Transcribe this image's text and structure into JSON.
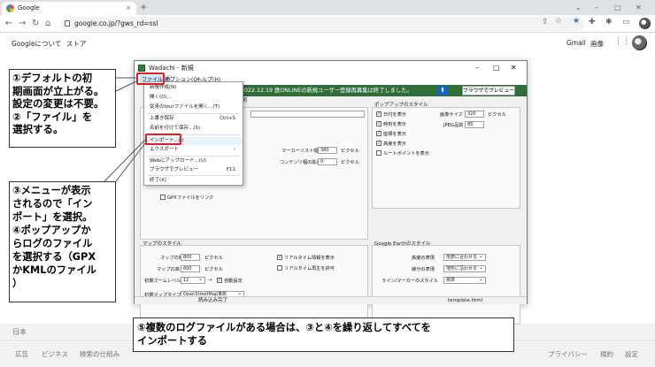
{
  "browser": {
    "tab_title": "Google",
    "tab_close": "×",
    "new_tab": "+",
    "url": "google.co.jp/?gws_rd=ssl",
    "window_controls": [
      "⌄",
      "–",
      "□",
      "✕"
    ]
  },
  "google": {
    "about": "Googleについて",
    "store": "ストア",
    "gmail": "Gmail",
    "images": "画像",
    "footer_country": "日本",
    "footer_left": [
      "広告",
      "ビジネス",
      "検索の仕組み"
    ],
    "footer_right": [
      "プライバシー",
      "規約",
      "設定"
    ]
  },
  "app": {
    "title": "Wadachi - 新規",
    "window_controls": [
      "–",
      "□",
      "✕"
    ],
    "menus": [
      "ファイル(F)",
      "オプション(O)",
      "ヘルプ(H)"
    ],
    "notice": "2022.12.19 鉄ONLINEの新規ユーザー登録再募集は終了しました。",
    "preview_button": "ブラウザでプレビュー",
    "tab_label": "説明",
    "file_menu": [
      {
        "label": "新規作成(N)",
        "shortcut": ""
      },
      {
        "label": "開く(O)...",
        "shortcut": ""
      },
      {
        "label": "従来のtourファイルを開く...(T)",
        "shortcut": ""
      },
      {
        "label": "上書き保存",
        "shortcut": "Ctrl+S"
      },
      {
        "label": "名前を付けて保存...(S)",
        "shortcut": ""
      },
      {
        "label": "インポート...(I)",
        "shortcut": ""
      },
      {
        "label": "エクスポート",
        "shortcut": "›"
      },
      {
        "label": "Webにアップロード...(U)",
        "shortcut": ""
      },
      {
        "label": "ブラウザでプレビュー",
        "shortcut": "F11"
      },
      {
        "label": "終了(X)",
        "shortcut": ""
      }
    ],
    "marker_list_width_label": "マーカーリスト幅",
    "marker_list_width": "380",
    "pixel": "ピクセル",
    "content_width_label": "コンテンツ幅の拡張",
    "content_width": "0",
    "gpx_checkbox": "GPXファイルをリンク",
    "popup_style": {
      "title": "ポップアップのスタイル",
      "checks": [
        "日付を表示",
        "時刻を表示",
        "座標を表示",
        "高度を表示",
        "ルートポイントを表示"
      ],
      "checked": [
        true,
        true,
        true,
        true,
        false
      ],
      "image_size_label": "画像サイズ",
      "image_size": "320",
      "jpeg_quality_label": "JPEG品質",
      "jpeg_quality": "85"
    },
    "map_style": {
      "title": "マップのスタイル",
      "map_width_label": "マップの幅",
      "map_width": "800",
      "map_height_label": "マップの高さ",
      "map_height": "600",
      "initial_zoom_label": "初期ズームレベル",
      "initial_zoom": "12",
      "auto_setting": "自動設定",
      "initial_map_type_label": "初期マップタイプ",
      "initial_map_type": "OpenStreetMap革新",
      "realtime_info": "リアルタイム情報を表示",
      "realtime_play": "リアルタイム再生を許可"
    },
    "earth_style": {
      "title": "Google Earthのスタイル",
      "altitude_label": "高度の表現",
      "altitude_value": "地表に合わせる",
      "line_label": "線分の表現",
      "line_value": "地形に沿わせる",
      "line_marker_label": "ライン/マーカーのスタイル",
      "line_marker_value": "標準"
    },
    "status_left": "読み込み完了",
    "status_right": "template.html"
  },
  "annotations": {
    "c1": [
      "①デフォルトの初",
      "期画面が立上がる。",
      "設定の変更は不要。",
      "②「ファイル」を",
      "選択する。"
    ],
    "c2": [
      "③メニューが表示",
      "されるので「イン",
      "ポート」を選択。",
      "④ポップアップか",
      "らログのファイル",
      "を選択する（GPX",
      "かKMLのファイル",
      "）"
    ],
    "c3": [
      "⑤複数のログファイルがある場合は、③と④を繰り返してすべてを",
      "インポートする"
    ]
  }
}
